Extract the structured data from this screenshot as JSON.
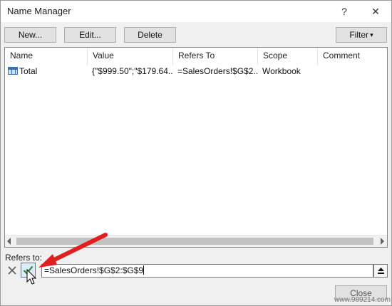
{
  "window": {
    "title": "Name Manager",
    "help_label": "?",
    "close_label": "✕"
  },
  "toolbar": {
    "new_label": "New...",
    "edit_label": "Edit...",
    "delete_label": "Delete",
    "filter_label": "Filter",
    "filter_arrow": "▾"
  },
  "list": {
    "columns": [
      "Name",
      "Value",
      "Refers To",
      "Scope",
      "Comment"
    ],
    "rows": [
      {
        "icon": "table-icon",
        "name": "Total",
        "value": "{\"$999.50\";\"$179.64...",
        "refers_to": "=SalesOrders!$G$2...",
        "scope": "Workbook",
        "comment": ""
      }
    ]
  },
  "refers": {
    "label": "Refers to:",
    "cancel_icon": "cancel-x-icon",
    "confirm_icon": "confirm-check-icon",
    "value": "=SalesOrders!$G$2:$G$9",
    "collapse_icon": "collapse-dialog-icon"
  },
  "footer": {
    "close_label": "Close"
  },
  "watermark": "www.989214.com",
  "colors": {
    "annotation_arrow": "#e02020",
    "confirm_check": "#2e8a2e"
  }
}
